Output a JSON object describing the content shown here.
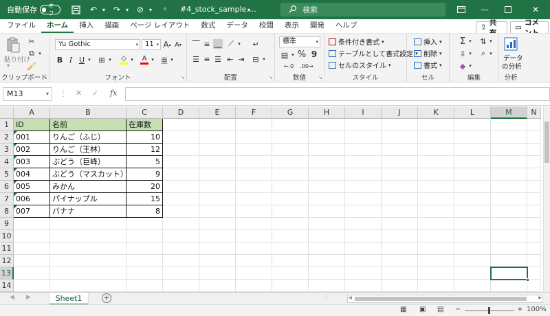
{
  "titlebar": {
    "autosave_label": "自動保存",
    "autosave_state": "オフ",
    "filename": "#4_stock_sample.…",
    "search_placeholder": "検索",
    "accent_color": "#217346"
  },
  "tabs": [
    "ファイル",
    "ホーム",
    "挿入",
    "描画",
    "ページ レイアウト",
    "数式",
    "データ",
    "校閲",
    "表示",
    "開発",
    "ヘルプ"
  ],
  "active_tab": "ホーム",
  "share_label": "共有",
  "comment_label": "コメント",
  "ribbon": {
    "clipboard": {
      "paste_label": "貼り付け",
      "group_label": "クリップボード"
    },
    "font": {
      "font_name": "Yu Gothic",
      "font_size": "11",
      "group_label": "フォント"
    },
    "alignment": {
      "group_label": "配置"
    },
    "number": {
      "format": "標準",
      "percent": "%",
      "comma": "9",
      "group_label": "数値"
    },
    "styles": {
      "conditional": "条件付き書式",
      "table": "テーブルとして書式設定",
      "cell_styles": "セルのスタイル",
      "group_label": "スタイル"
    },
    "cells": {
      "insert": "挿入",
      "delete": "削除",
      "format": "書式",
      "group_label": "セル"
    },
    "editing": {
      "group_label": "編集"
    },
    "analysis": {
      "analyze_line1": "データ",
      "analyze_line2": "の分析",
      "group_label": "分析"
    }
  },
  "formula_bar": {
    "name_box": "M13",
    "fx": "fx",
    "formula": ""
  },
  "columns": [
    "A",
    "B",
    "C",
    "D",
    "E",
    "F",
    "G",
    "H",
    "I",
    "J",
    "K",
    "L",
    "M",
    "N"
  ],
  "selected_column": "M",
  "rows": [
    "1",
    "2",
    "3",
    "4",
    "5",
    "6",
    "7",
    "8",
    "9",
    "10",
    "11",
    "12",
    "13",
    "14"
  ],
  "selected_row": "13",
  "table": {
    "header": [
      "ID",
      "名前",
      "在庫数"
    ],
    "rows": [
      [
        "001",
        "りんご（ふじ）",
        "10"
      ],
      [
        "002",
        "りんご（王林）",
        "12"
      ],
      [
        "003",
        "ぶどう（巨峰）",
        "5"
      ],
      [
        "004",
        "ぶどう（マスカット）",
        "9"
      ],
      [
        "005",
        "みかん",
        "20"
      ],
      [
        "006",
        "パイナップル",
        "15"
      ],
      [
        "007",
        "バナナ",
        "8"
      ]
    ],
    "header_fill": "#c6e0b4"
  },
  "sheet_tabs": [
    "Sheet1"
  ],
  "status": {
    "zoom": "100%"
  }
}
